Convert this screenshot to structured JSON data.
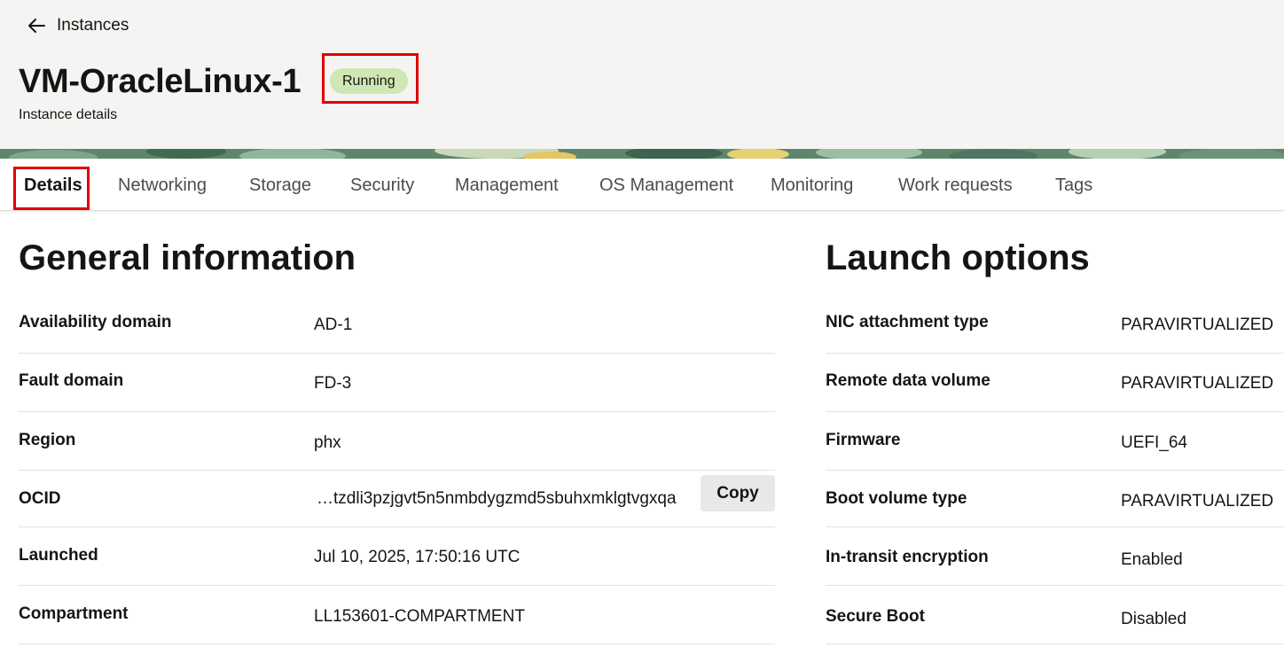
{
  "header": {
    "back_label": "Instances",
    "title": "VM-OracleLinux-1",
    "status": "Running",
    "subtitle": "Instance details"
  },
  "tabs": [
    {
      "label": "Details",
      "active": true
    },
    {
      "label": "Networking"
    },
    {
      "label": "Storage"
    },
    {
      "label": "Security"
    },
    {
      "label": "Management"
    },
    {
      "label": "OS Management"
    },
    {
      "label": "Monitoring"
    },
    {
      "label": "Work requests"
    },
    {
      "label": "Tags"
    }
  ],
  "general": {
    "title": "General information",
    "rows": [
      {
        "label": "Availability domain",
        "value": "AD-1"
      },
      {
        "label": "Fault domain",
        "value": "FD-3"
      },
      {
        "label": "Region",
        "value": "phx"
      },
      {
        "label": "OCID",
        "value": "…tzdli3pzjgvt5n5nmbdygzmd5sbuhxmklgtvgxqa",
        "action": "Copy"
      },
      {
        "label": "Launched",
        "value": "Jul 10, 2025, 17:50:16 UTC"
      },
      {
        "label": "Compartment",
        "value": "LL153601-COMPARTMENT"
      }
    ]
  },
  "launch": {
    "title": "Launch options",
    "rows": [
      {
        "label": "NIC attachment type",
        "value": "PARAVIRTUALIZED"
      },
      {
        "label": "Remote data volume",
        "value": "PARAVIRTUALIZED"
      },
      {
        "label": "Firmware",
        "value": "UEFI_64"
      },
      {
        "label": "Boot volume type",
        "value": "PARAVIRTUALIZED"
      },
      {
        "label": "In-transit encryption",
        "value": "Enabled"
      },
      {
        "label": "Secure Boot",
        "value": "Disabled"
      }
    ]
  },
  "colors": {
    "status_badge": "#cfe7b4",
    "highlight_box": "#e00000",
    "header_bg": "#f5f4f2"
  },
  "icons": {
    "back": "arrow-left-icon"
  }
}
